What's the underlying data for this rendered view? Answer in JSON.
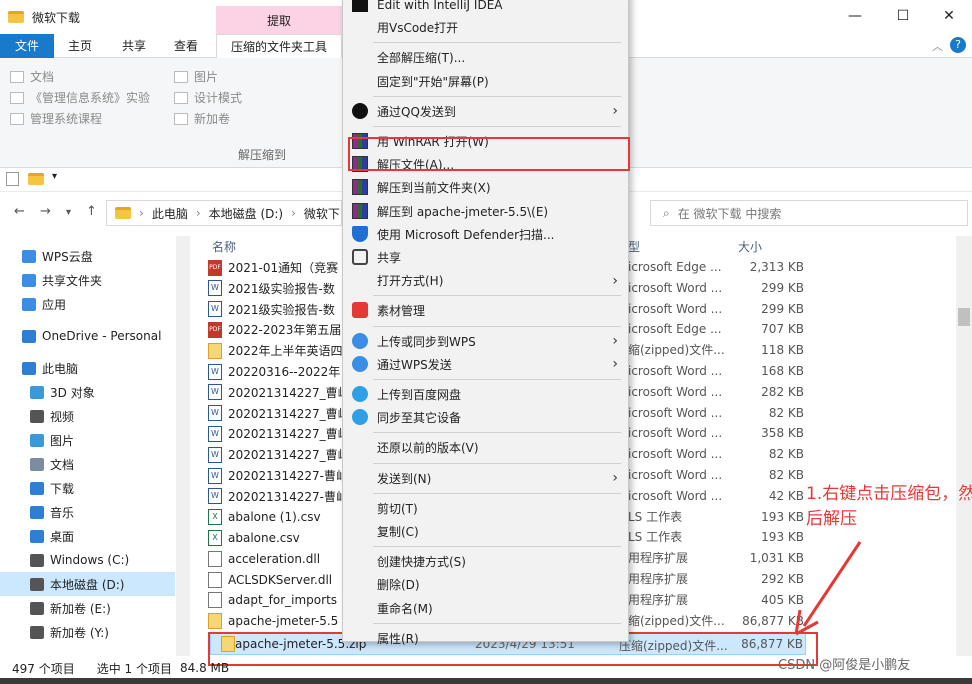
{
  "window": {
    "title": "微软下载",
    "context_tab": "提取",
    "minimize": "—",
    "maximize": "☐",
    "close": "✕"
  },
  "ribbon": {
    "tabs": [
      "文件",
      "主页",
      "共享",
      "查看",
      "压缩的文件夹工具"
    ],
    "col1": [
      "文档",
      "《管理信息系统》实验",
      "管理系统课程"
    ],
    "col2": [
      "图片",
      "设计模式",
      "新加卷"
    ],
    "group_label": "解压缩到"
  },
  "address": {
    "crumbs": [
      "此电脑",
      "本地磁盘 (D:)",
      "微软下"
    ],
    "search_placeholder": "在 微软下载 中搜索"
  },
  "sidebar": {
    "items": [
      {
        "label": "WPS云盘",
        "color": "#3a8ee6"
      },
      {
        "label": "共享文件夹",
        "color": "#3a8ee6"
      },
      {
        "label": "应用",
        "color": "#3a8ee6"
      },
      {
        "label": "OneDrive - Personal",
        "color": "#2d7fd6"
      },
      {
        "label": "此电脑",
        "color": "#2d7fd6"
      },
      {
        "label": "3D 对象",
        "color": "#3a9ad9"
      },
      {
        "label": "视频",
        "color": "#555555"
      },
      {
        "label": "图片",
        "color": "#3a9ad9"
      },
      {
        "label": "文档",
        "color": "#7a8ca0"
      },
      {
        "label": "下载",
        "color": "#2d7fd6"
      },
      {
        "label": "音乐",
        "color": "#2d7fd6"
      },
      {
        "label": "桌面",
        "color": "#2d7fd6"
      },
      {
        "label": "Windows (C:)",
        "color": "#555555"
      },
      {
        "label": "本地磁盘 (D:)",
        "color": "#555555"
      },
      {
        "label": "新加卷 (E:)",
        "color": "#555555"
      },
      {
        "label": "新加卷 (Y:)",
        "color": "#555555"
      }
    ],
    "selected_index": 13
  },
  "files": {
    "col_name": "名称",
    "col_type": "型",
    "col_size": "大小",
    "rows": [
      {
        "name": "2021-01通知（竞赛",
        "icon": "pdf",
        "type": "icrosoft Edge ...",
        "size": "2,313 KB"
      },
      {
        "name": "2021级实验报告-数",
        "icon": "doc",
        "type": "icrosoft Word ...",
        "size": "299 KB"
      },
      {
        "name": "2021级实验报告-数",
        "icon": "doc",
        "type": "icrosoft Word ...",
        "size": "299 KB"
      },
      {
        "name": "2022-2023年第五届",
        "icon": "pdf",
        "type": "icrosoft Edge ...",
        "size": "707 KB"
      },
      {
        "name": "2022年上半年英语四",
        "icon": "zip",
        "type": "缩(zipped)文件...",
        "size": "118 KB"
      },
      {
        "name": "20220316--2022年",
        "icon": "doc",
        "type": "icrosoft Word ...",
        "size": "168 KB"
      },
      {
        "name": "202021314227_曹屾",
        "icon": "doc",
        "type": "icrosoft Word ...",
        "size": "282 KB"
      },
      {
        "name": "202021314227_曹屾",
        "icon": "doc",
        "type": "icrosoft Word ...",
        "size": "82 KB"
      },
      {
        "name": "202021314227_曹屾",
        "icon": "doc",
        "type": "icrosoft Word ...",
        "size": "358 KB"
      },
      {
        "name": "202021314227_曹屾",
        "icon": "doc",
        "type": "icrosoft Word ...",
        "size": "82 KB"
      },
      {
        "name": "202021314227-曹屾",
        "icon": "doc",
        "type": "icrosoft Word ...",
        "size": "82 KB"
      },
      {
        "name": "202021314227-曹屾",
        "icon": "doc",
        "type": "icrosoft Word ...",
        "size": "42 KB"
      },
      {
        "name": "abalone (1).csv",
        "icon": "csv",
        "type": "LS 工作表",
        "size": "193 KB"
      },
      {
        "name": "abalone.csv",
        "icon": "csv",
        "type": "LS 工作表",
        "size": "193 KB"
      },
      {
        "name": "acceleration.dll",
        "icon": "dll",
        "type": "用程序扩展",
        "size": "1,031 KB"
      },
      {
        "name": "ACLSDKServer.dll",
        "icon": "dll",
        "type": "用程序扩展",
        "size": "292 KB"
      },
      {
        "name": "adapt_for_imports",
        "icon": "dll",
        "type": "用程序扩展",
        "size": "405 KB"
      },
      {
        "name": "apache-jmeter-5.5",
        "icon": "zip",
        "type": "缩(zipped)文件...",
        "size": "86,877 KB"
      }
    ],
    "selected": {
      "name": "apache-jmeter-5.5.zip",
      "date": "2023/4/29 13:51",
      "type": "压缩(zipped)文件...",
      "size": "86,877 KB"
    }
  },
  "context_menu": {
    "items": [
      {
        "label": "Edit with IntelliJ IDEA",
        "icon": "idea",
        "sub": false
      },
      {
        "label": "用VsCode打开",
        "icon": "none",
        "sub": false
      },
      {
        "sep": true
      },
      {
        "label": "全部解压缩(T)...",
        "icon": "none",
        "sub": false
      },
      {
        "label": "固定到\"开始\"屏幕(P)",
        "icon": "none",
        "sub": false
      },
      {
        "sep": true
      },
      {
        "label": "通过QQ发送到",
        "icon": "qq",
        "sub": true
      },
      {
        "sep": true
      },
      {
        "label": "用 WinRAR 打开(W)",
        "icon": "rar",
        "sub": false
      },
      {
        "label": "解压文件(A)...",
        "icon": "rar",
        "sub": false,
        "highlight": true
      },
      {
        "label": "解压到当前文件夹(X)",
        "icon": "rar",
        "sub": false
      },
      {
        "label": "解压到 apache-jmeter-5.5\\(E)",
        "icon": "rar",
        "sub": false
      },
      {
        "label": "使用 Microsoft Defender扫描...",
        "icon": "shield",
        "sub": false
      },
      {
        "label": "共享",
        "icon": "share",
        "sub": false
      },
      {
        "label": "打开方式(H)",
        "icon": "none",
        "sub": true
      },
      {
        "sep": true
      },
      {
        "label": "素材管理",
        "icon": "wps",
        "sub": false
      },
      {
        "sep": true
      },
      {
        "label": "上传或同步到WPS",
        "icon": "cloud",
        "sub": true
      },
      {
        "label": "通过WPS发送",
        "icon": "send",
        "sub": true
      },
      {
        "sep": true
      },
      {
        "label": "上传到百度网盘",
        "icon": "baidu",
        "sub": false
      },
      {
        "label": "同步至其它设备",
        "icon": "baidu",
        "sub": false
      },
      {
        "sep": true
      },
      {
        "label": "还原以前的版本(V)",
        "icon": "none",
        "sub": false
      },
      {
        "sep": true
      },
      {
        "label": "发送到(N)",
        "icon": "none",
        "sub": true
      },
      {
        "sep": true
      },
      {
        "label": "剪切(T)",
        "icon": "none",
        "sub": false
      },
      {
        "label": "复制(C)",
        "icon": "none",
        "sub": false
      },
      {
        "sep": true
      },
      {
        "label": "创建快捷方式(S)",
        "icon": "none",
        "sub": false
      },
      {
        "label": "删除(D)",
        "icon": "none",
        "sub": false
      },
      {
        "label": "重命名(M)",
        "icon": "none",
        "sub": false
      },
      {
        "sep": true
      },
      {
        "label": "属性(R)",
        "icon": "none",
        "sub": false
      }
    ]
  },
  "status": {
    "count": "497 个项目",
    "selected": "选中 1 个项目",
    "size": "84.8 MB"
  },
  "annotation": "1.右键点击压缩包，然后解压",
  "watermark": "CSDN @阿俊是小鹏友",
  "colors": {
    "accent": "#1979ca",
    "highlight_red": "#e53935",
    "selection": "#cce8ff"
  }
}
